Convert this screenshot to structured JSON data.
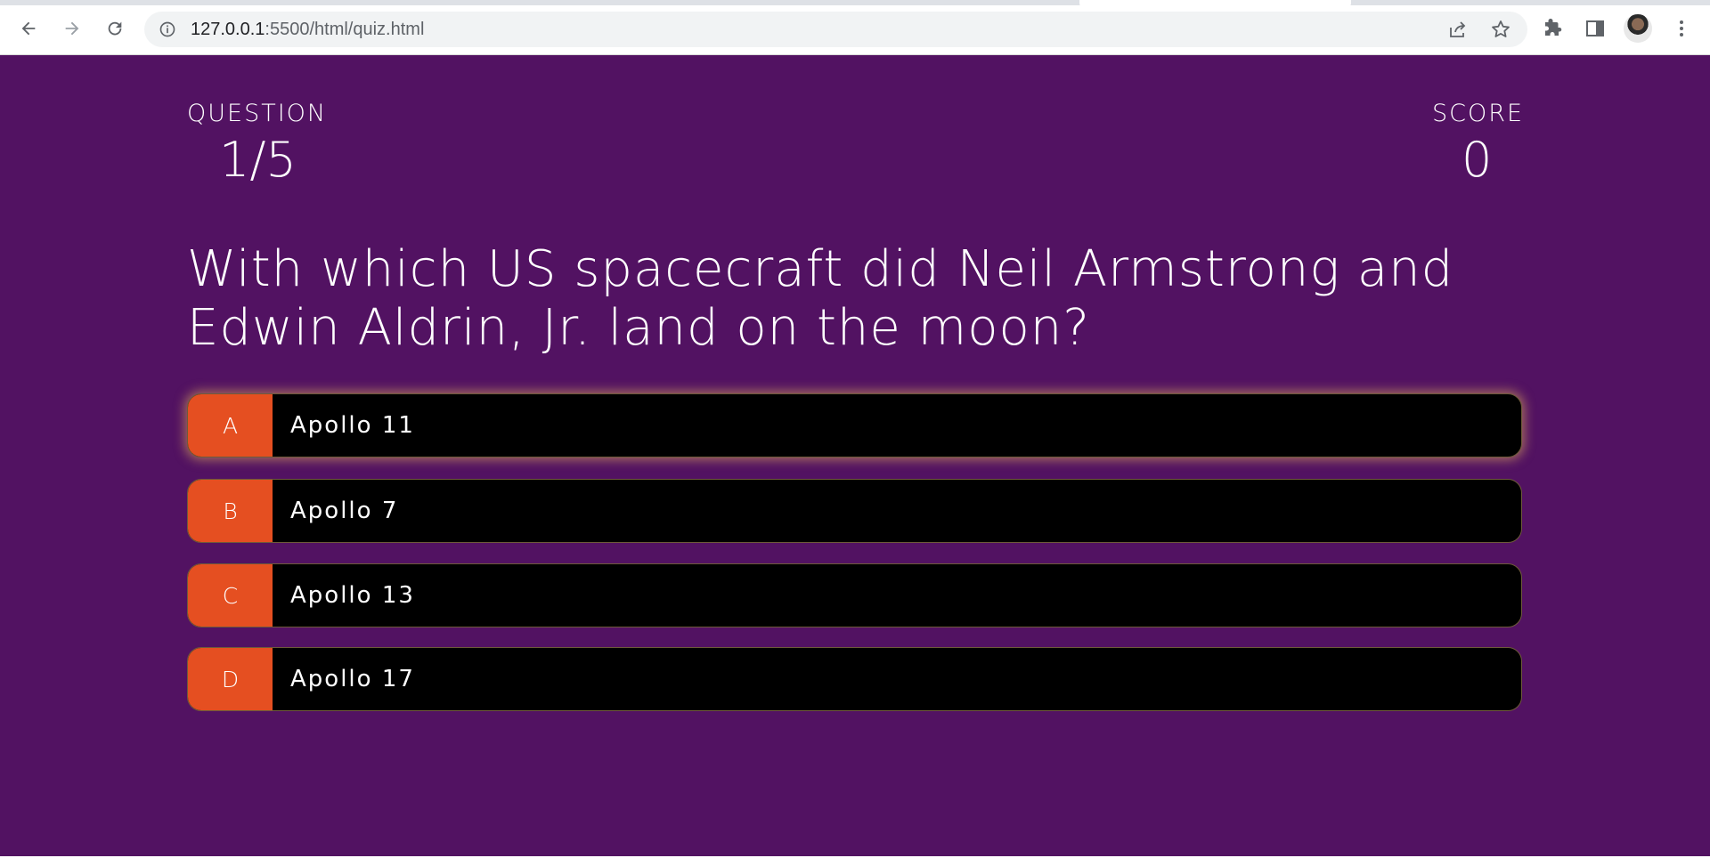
{
  "browser": {
    "url_host": "127.0.0.1",
    "url_rest": ":5500/html/quiz.html"
  },
  "hud": {
    "question_label": "QUESTION",
    "question_progress": "1/5",
    "score_label": "SCORE",
    "score_value": "0"
  },
  "question": {
    "text": "With which US spacecraft did Neil Armstrong and Edwin Aldrin, Jr. land on the moon?"
  },
  "choices": [
    {
      "prefix": "A",
      "text": "Apollo 11"
    },
    {
      "prefix": "B",
      "text": "Apollo 7"
    },
    {
      "prefix": "C",
      "text": "Apollo 13"
    },
    {
      "prefix": "D",
      "text": "Apollo 17"
    }
  ],
  "colors": {
    "background": "#521262",
    "prefix": "#e54f21",
    "choice_bg": "#000000"
  }
}
